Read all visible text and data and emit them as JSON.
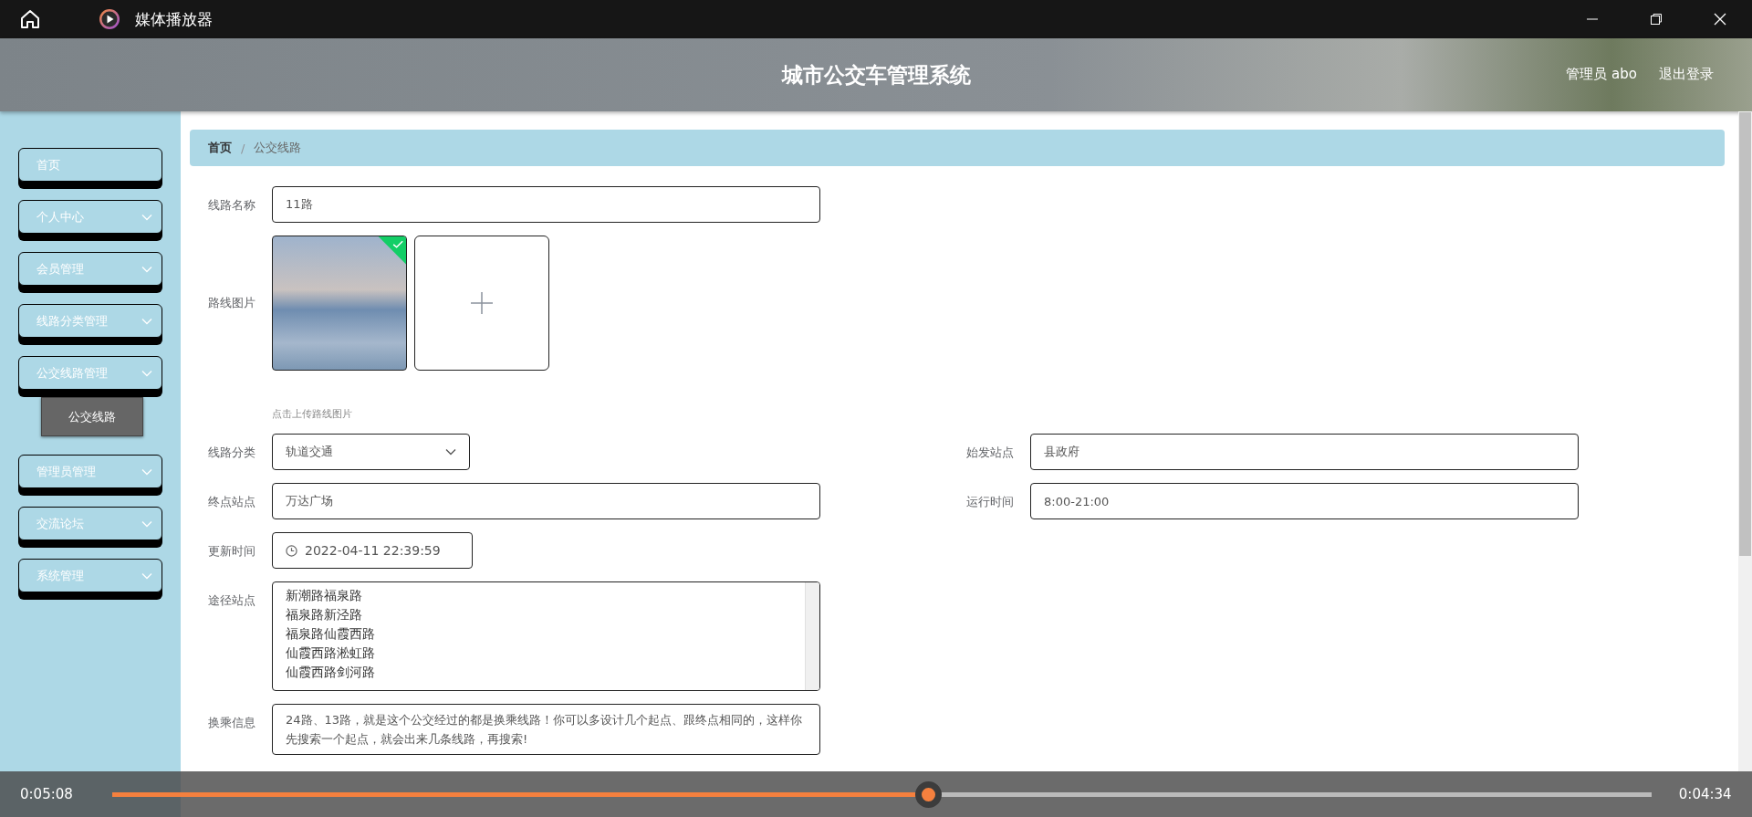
{
  "window": {
    "title": "媒体播放器"
  },
  "header": {
    "title": "城市公交车管理系统",
    "user": "管理员 abo",
    "logout": "退出登录"
  },
  "sidebar": {
    "items": [
      {
        "label": "首页",
        "kind": "link"
      },
      {
        "label": "个人中心",
        "kind": "menu"
      },
      {
        "label": "会员管理",
        "kind": "menu"
      },
      {
        "label": "线路分类管理",
        "kind": "menu"
      },
      {
        "label": "公交线路管理",
        "kind": "menu",
        "children": [
          {
            "label": "公交线路",
            "selected": true
          }
        ]
      },
      {
        "label": "管理员管理",
        "kind": "menu"
      },
      {
        "label": "交流论坛",
        "kind": "menu"
      },
      {
        "label": "系统管理",
        "kind": "menu"
      }
    ]
  },
  "breadcrumb": [
    {
      "label": "首页",
      "current": false
    },
    {
      "label": "公交线路",
      "current": true
    }
  ],
  "breadcrumb_separator": "/",
  "form": {
    "rows": [
      {
        "fields": [
          {
            "kind": "text",
            "label": "线路名称",
            "value": "11路"
          }
        ]
      },
      {
        "fields": [
          {
            "kind": "images",
            "label": "路线图片",
            "images": [
              {
                "success": true
              }
            ],
            "hint": "点击上传路线图片"
          }
        ]
      },
      {
        "fields": [
          {
            "kind": "select",
            "label": "线路分类",
            "value": "轨道交通"
          },
          {
            "kind": "text",
            "label": "始发站点",
            "value": "县政府"
          }
        ]
      },
      {
        "fields": [
          {
            "kind": "text",
            "label": "终点站点",
            "value": "万达广场"
          },
          {
            "kind": "text",
            "label": "运行时间",
            "value": "8:00-21:00"
          }
        ]
      },
      {
        "fields": [
          {
            "kind": "datetime",
            "label": "更新时间",
            "value": "2022-04-11 22:39:59"
          }
        ]
      },
      {
        "fields": [
          {
            "kind": "list",
            "label": "途径站点",
            "lines": [
              "新潮路福泉路",
              "福泉路新泾路",
              "福泉路仙霞西路",
              "仙霞西路淞虹路",
              "仙霞西路剑河路"
            ]
          }
        ]
      },
      {
        "fields": [
          {
            "kind": "textarea",
            "label": "换乘信息",
            "value": "24路、13路，就是这个公交经过的都是换乘线路！你可以多设计几个起点、跟终点相同的，这样你先搜索一个起点，就会出来几条线路，再搜索!"
          }
        ]
      }
    ]
  },
  "player": {
    "elapsed": "0:05:08",
    "remaining": "0:04:34",
    "level": 0.53
  }
}
